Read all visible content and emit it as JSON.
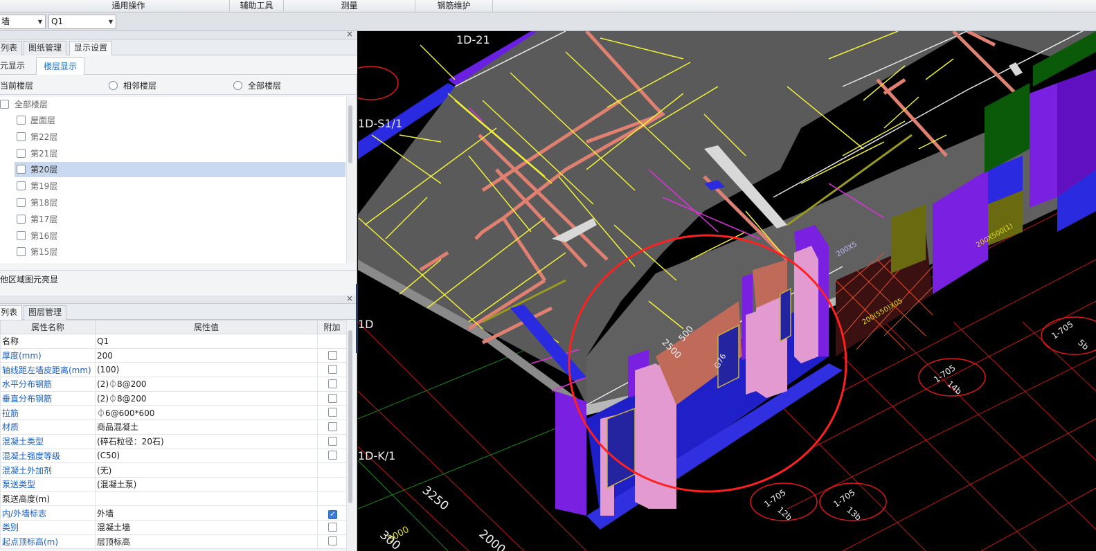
{
  "ribbon": {
    "groups": [
      "通用操作",
      "辅助工具",
      "测量",
      "钢筋维护"
    ]
  },
  "selectors": {
    "type_value": "墙",
    "element_value": "Q1"
  },
  "display_panel": {
    "tabs": [
      "列表",
      "图纸管理",
      "显示设置"
    ],
    "subtabs": [
      "元显示",
      "楼层显示"
    ],
    "radio_options": [
      "当前楼层",
      "相邻楼层",
      "全部楼层"
    ],
    "floors": [
      "全部楼层",
      "屋面层",
      "第22层",
      "第21层",
      "第20层",
      "第19层",
      "第18层",
      "第17层",
      "第16层",
      "第15层"
    ],
    "selected_floor": "第20层",
    "other_region_label": "他区域图元亮显"
  },
  "property_panel": {
    "tabs": [
      "列表",
      "图层管理"
    ],
    "headers": [
      "属性名称",
      "属性值",
      "附加"
    ],
    "rows": [
      {
        "name": "名称",
        "value": "Q1",
        "extra": ""
      },
      {
        "name": "厚度(mm)",
        "value": "200",
        "extra": "box"
      },
      {
        "name": "轴线距左墙皮距离(mm)",
        "value": "(100)",
        "extra": "box"
      },
      {
        "name": "水平分布钢筋",
        "value": "(2)⏀8@200",
        "extra": "box"
      },
      {
        "name": "垂直分布钢筋",
        "value": "(2)⏀8@200",
        "extra": "box"
      },
      {
        "name": "拉筋",
        "value": "⏀6@600*600",
        "extra": "box"
      },
      {
        "name": "材质",
        "value": "商品混凝土",
        "extra": "box"
      },
      {
        "name": "混凝土类型",
        "value": "(碎石粒径：20石)",
        "extra": "box"
      },
      {
        "name": "混凝土强度等级",
        "value": "(C50)",
        "extra": "box"
      },
      {
        "name": "混凝土外加剂",
        "value": "(无)",
        "extra": ""
      },
      {
        "name": "泵送类型",
        "value": "(混凝土泵)",
        "extra": ""
      },
      {
        "name": "泵送高度(m)",
        "value": "",
        "extra": ""
      },
      {
        "name": "内/外墙标志",
        "value": "外墙",
        "extra": "checked"
      },
      {
        "name": "类别",
        "value": "混凝土墙",
        "extra": "box"
      },
      {
        "name": "起点顶标高(m)",
        "value": "层顶标高",
        "extra": "box"
      }
    ]
  },
  "viewport": {
    "axis_labels": [
      "1D-21",
      "1D-S1/1",
      "1D",
      "1D-K/1"
    ],
    "dimensions": [
      "3250",
      "3000",
      "300",
      "2000",
      "2500",
      "500"
    ],
    "beam_labels": [
      "1-705",
      "1-705",
      "1-705",
      "1-705"
    ],
    "beam_sub_labels": [
      "14b",
      "12b",
      "13b",
      "5b"
    ],
    "vertical_text": [
      "200(550)X05",
      "200X500(1)",
      "G76",
      "200X5"
    ],
    "colors": {
      "slab": "#5a5a5a",
      "wall_purple": "#7a20e0",
      "column_pink": "#e39ad0",
      "beam_salmon": "#e08070",
      "rebar_yellow": "#f2f23a",
      "base_blue": "#2a2ae0",
      "grid_red": "#d01818",
      "mark_circle": "#ff2020",
      "green_block": "#0a5a0a"
    }
  }
}
